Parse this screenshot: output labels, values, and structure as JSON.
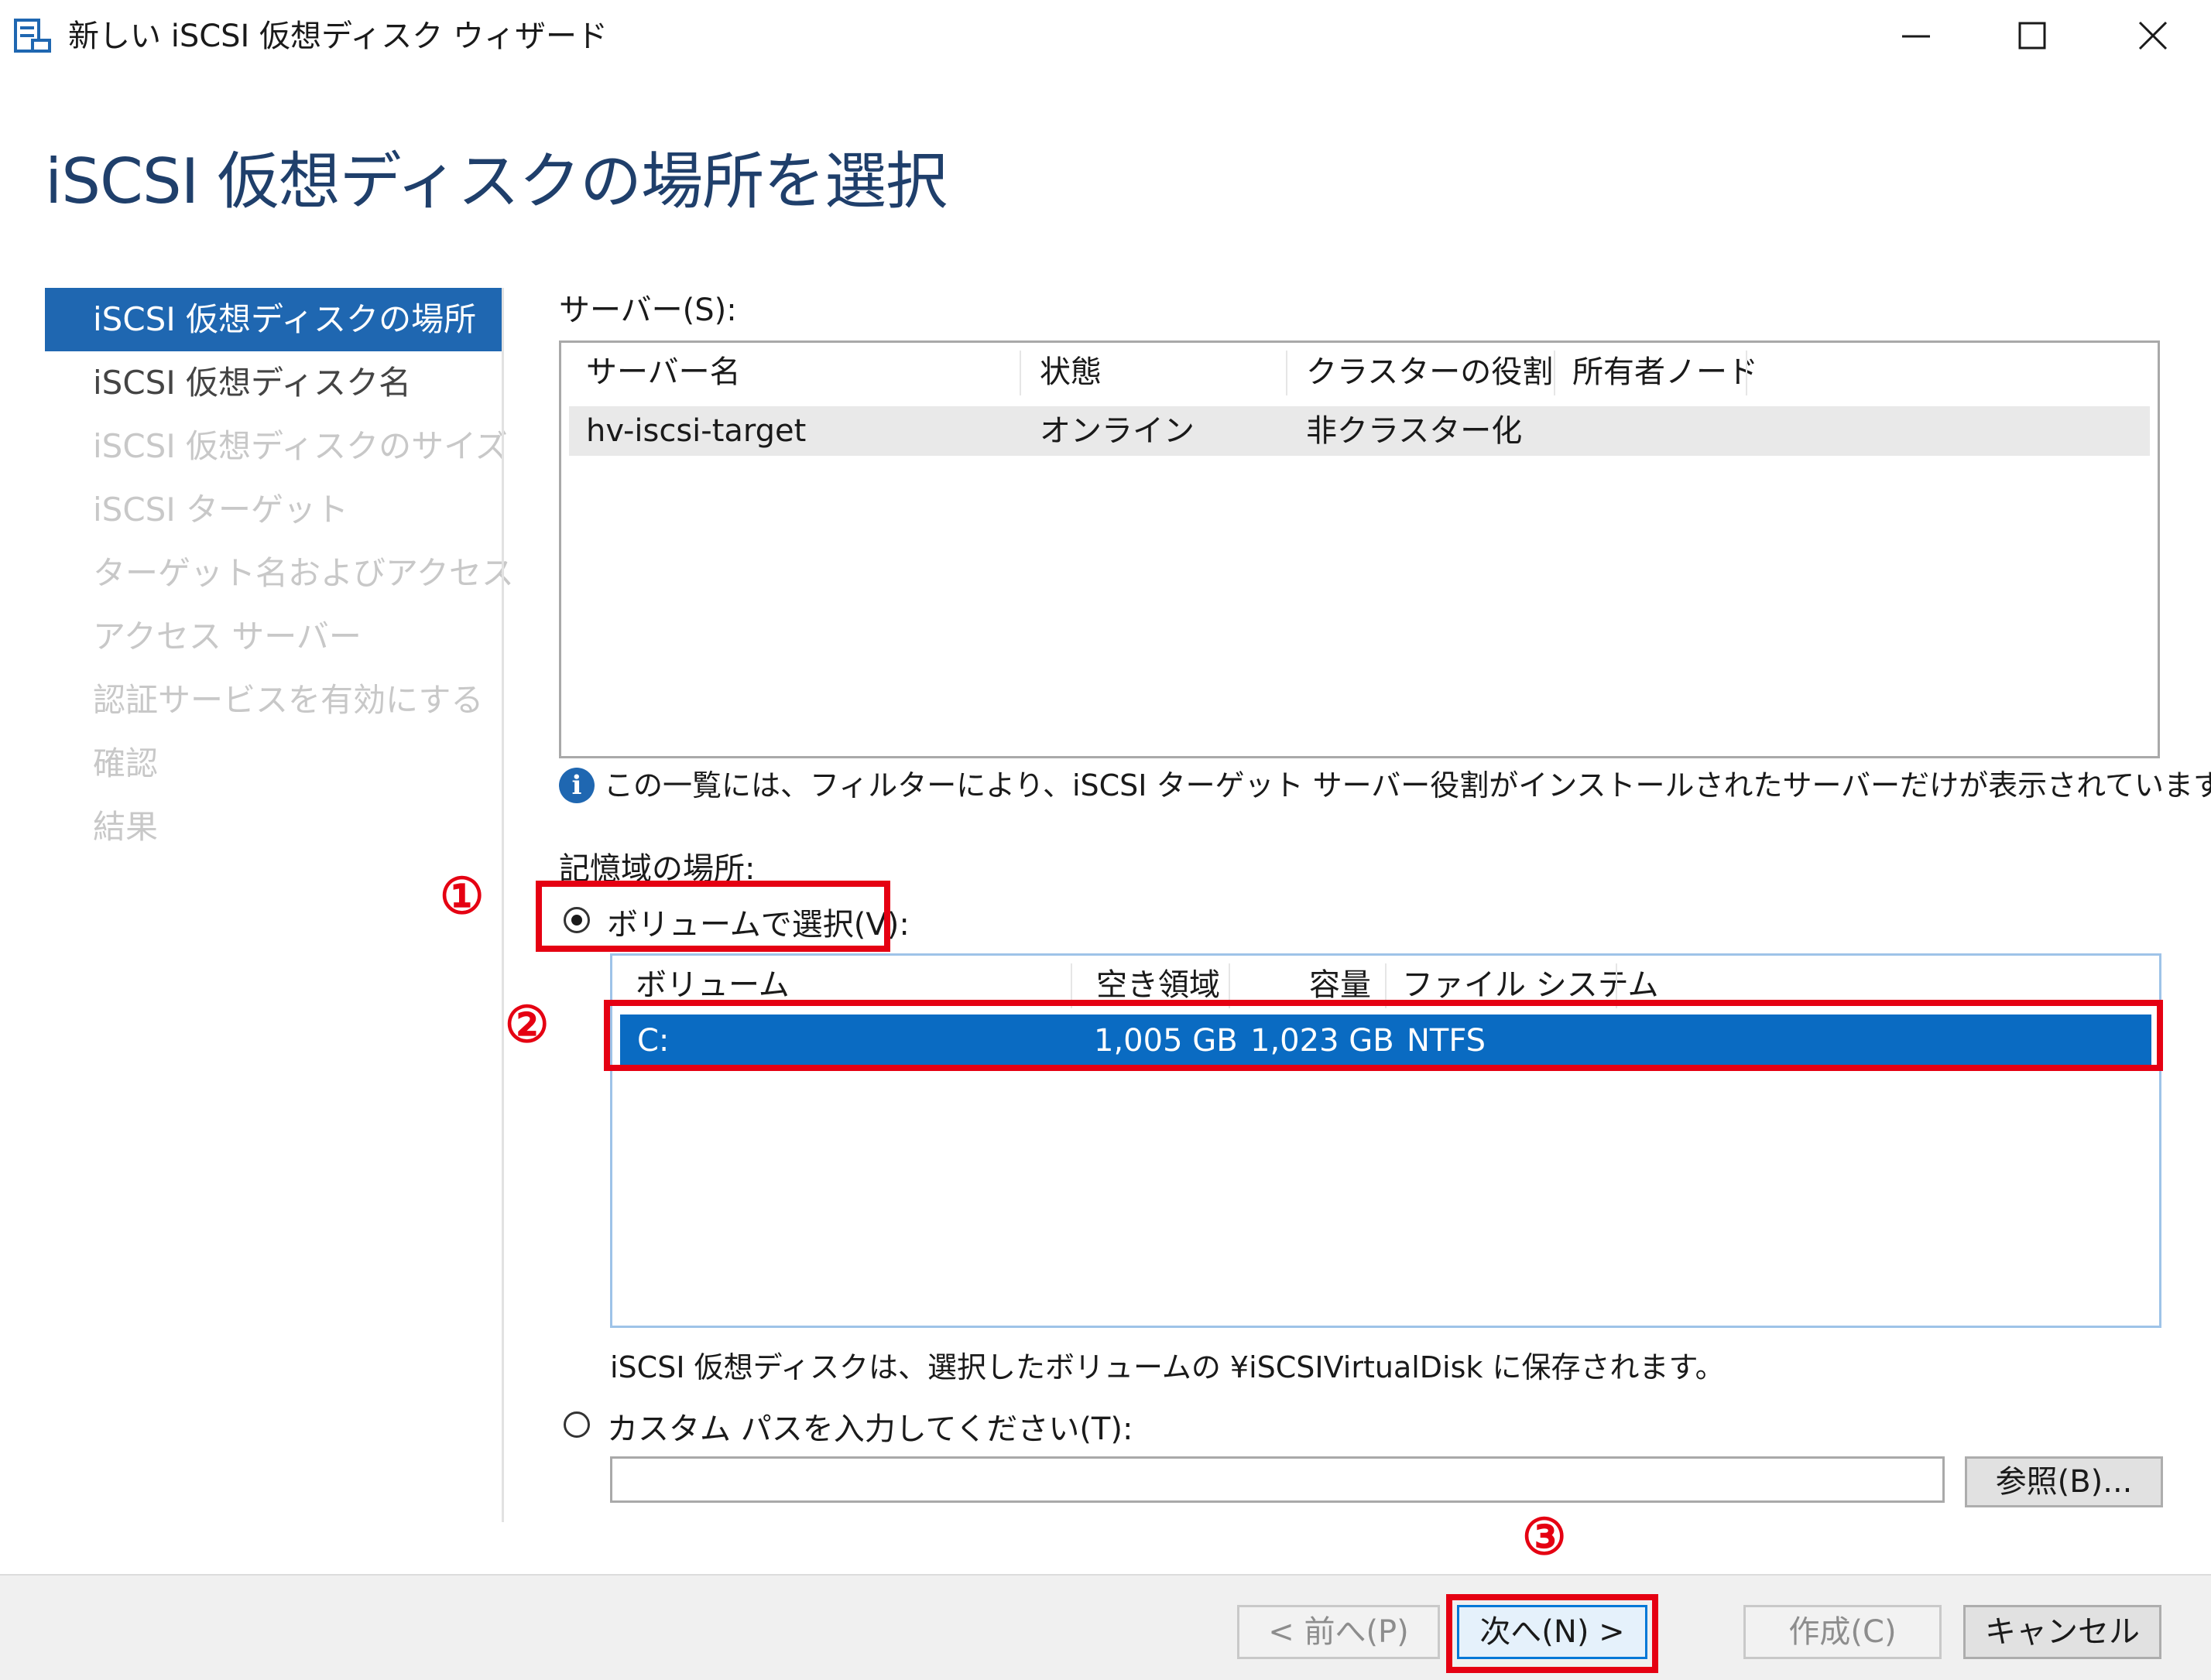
{
  "window": {
    "title": "新しい iSCSI 仮想ディスク ウィザード",
    "minimize_glyph": "—",
    "maximize_glyph": "☐",
    "close_glyph": "✕"
  },
  "heading": "iSCSI 仮想ディスクの場所を選択",
  "nav": {
    "items": [
      {
        "label": "iSCSI 仮想ディスクの場所",
        "state": "active"
      },
      {
        "label": "iSCSI 仮想ディスク名",
        "state": "normal"
      },
      {
        "label": "iSCSI 仮想ディスクのサイズ",
        "state": "disabled"
      },
      {
        "label": "iSCSI ターゲット",
        "state": "disabled"
      },
      {
        "label": "ターゲット名およびアクセス",
        "state": "disabled"
      },
      {
        "label": "アクセス サーバー",
        "state": "disabled"
      },
      {
        "label": "認証サービスを有効にする",
        "state": "disabled"
      },
      {
        "label": "確認",
        "state": "disabled"
      },
      {
        "label": "結果",
        "state": "disabled"
      }
    ]
  },
  "server": {
    "label": "サーバー(S):",
    "columns": [
      "サーバー名",
      "状態",
      "クラスターの役割",
      "所有者ノード"
    ],
    "rows": [
      {
        "name": "hv-iscsi-target",
        "status": "オンライン",
        "cluster_role": "非クラスター化",
        "owner_node": ""
      }
    ]
  },
  "info": {
    "icon": "info-icon",
    "text": "この一覧には、フィルターにより、iSCSI ターゲット サーバー役割がインストールされたサーバーだけが表示されています。"
  },
  "storage": {
    "label": "記憶域の場所:",
    "by_volume_label": "ボリュームで選択(V):",
    "by_volume_selected": true,
    "volume_columns": [
      "ボリューム",
      "空き領域",
      "容量",
      "ファイル システム"
    ],
    "volumes": [
      {
        "volume": "C:",
        "free": "1,005 GB",
        "capacity": "1,023 GB",
        "fs": "NTFS",
        "selected": true
      }
    ],
    "note": "iSCSI 仮想ディスクは、選択したボリュームの ¥iSCSIVirtualDisk に保存されます。",
    "custom_path_label": "カスタム パスを入力してください(T):",
    "custom_path_value": "",
    "browse_label": "参照(B)..."
  },
  "footer": {
    "prev_label": "< 前へ(P)",
    "next_label": "次へ(N) >",
    "create_label": "作成(C)",
    "cancel_label": "キャンセル"
  },
  "annotations": {
    "step1": "①",
    "step2": "②",
    "step3": "③",
    "color": "#e50012"
  },
  "colors": {
    "accent": "#1f67b1",
    "selection": "#0a6bc2",
    "heading": "#1f3f6b"
  }
}
